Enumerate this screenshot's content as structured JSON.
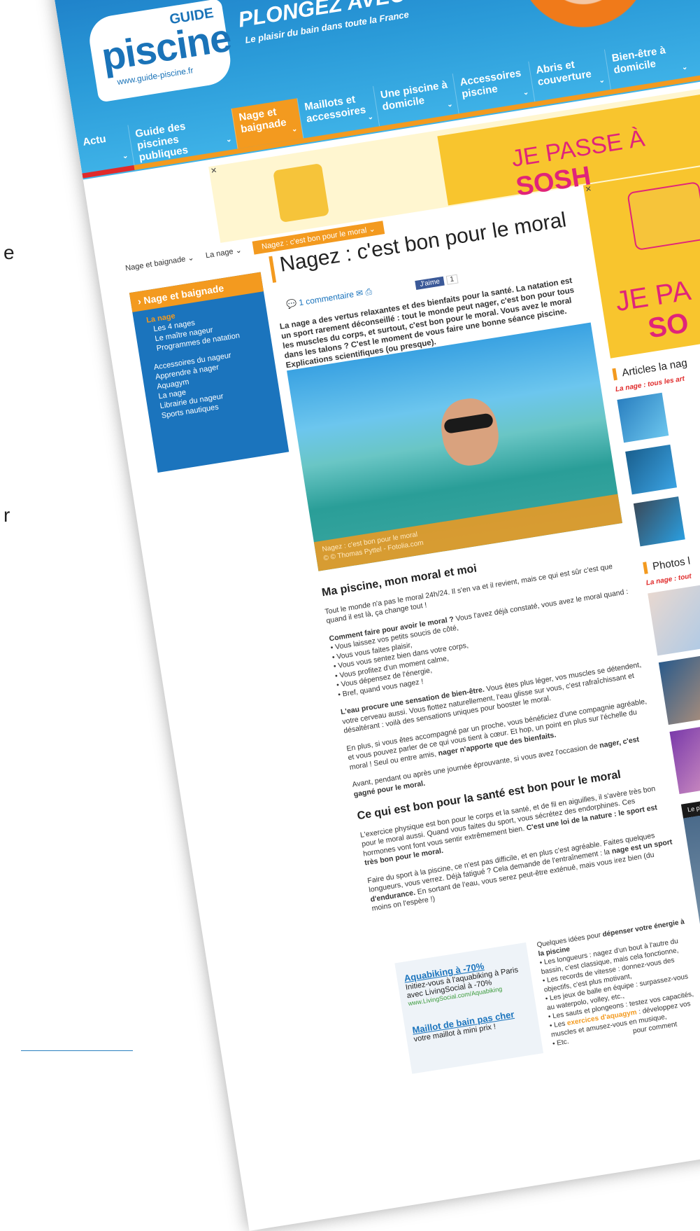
{
  "edge_letters": [
    "e",
    "r"
  ],
  "header": {
    "logo_guide": "GUIDE",
    "logo_piscine": "piscine",
    "logo_url": "www.guide-piscine.fr",
    "slogan": "PLONGEZ AVEC NOUS !",
    "subslogan": "Le plaisir du bain dans toute la France"
  },
  "nav": [
    {
      "label": "Actu"
    },
    {
      "label": "Guide des piscines publiques"
    },
    {
      "label": "Nage et baignade"
    },
    {
      "label": "Maillots et accessoires"
    },
    {
      "label": "Une piscine à domicile"
    },
    {
      "label": "Accessoires piscine"
    },
    {
      "label": "Abris et couverture"
    },
    {
      "label": "Bien-être à domicile"
    }
  ],
  "banner": {
    "text": "JE PASSE À",
    "brand": "SOSH"
  },
  "breadcrumb": [
    "Nage et baignade",
    "La nage",
    "Nagez : c'est bon pour le moral"
  ],
  "sidebar": {
    "heading": "Nage et baignade",
    "items": [
      {
        "label": "La nage"
      },
      {
        "label": "Les 4 nages"
      },
      {
        "label": "Le maître nageur"
      },
      {
        "label": "Programmes de natation"
      },
      {
        "label": "Accessoires du nageur"
      },
      {
        "label": "Apprendre à nager"
      },
      {
        "label": "Aquagym"
      },
      {
        "label": "La nage"
      },
      {
        "label": "Librairie du nageur"
      },
      {
        "label": "Sports nautiques"
      }
    ]
  },
  "article": {
    "title": "Nagez : c'est bon pour le moral",
    "comments": "1 commentaire",
    "like": "J'aime",
    "like_count": "1",
    "intro": "La nage a des vertus relaxantes et des bienfaits pour la santé. La natation est un sport rarement déconseillé : tout le monde peut nager, c'est bon pour tous les muscles du corps, et surtout, c'est bon pour le moral. Vous avez le moral dans les talons ? C'est le moment de vous faire une bonne séance piscine. Explications scientifiques (ou presque).",
    "photo_caption": "Nagez : c'est bon pour le moral",
    "photo_credit": "© © Thomas Pyttel - Fotolia.com",
    "h2_1": "Ma piscine, mon moral et moi",
    "p1": "Tout le monde n'a pas le moral 24h/24. Il s'en va et il revient, mais ce qui est sûr c'est que quand il est là, ça change tout !",
    "p2_lead": "Comment faire pour avoir le moral ?",
    "p2_rest": "Vous l'avez déjà constaté, vous avez le moral quand :",
    "list1": [
      "• Vous laissez vos petits soucis de côté,",
      "• Vous vous faites plaisir,",
      "• Vous vous sentez bien dans votre corps,",
      "• Vous profitez d'un moment calme,",
      "• Vous dépensez de l'énergie,",
      "• Bref, quand vous nagez !"
    ],
    "p3_lead": "L'eau procure une sensation de bien-être.",
    "p3_rest": "Vous êtes plus léger, vos muscles se détendent, votre cerveau aussi. Vous flottez naturellement, l'eau glisse sur vous, c'est rafraîchissant et désaltérant : voilà des sensations uniques pour booster le moral.",
    "p4_a": "En plus, si vous êtes accompagné par un proche, vous bénéficiez d'une compagnie agréable, et vous pouvez parler de ce qui vous tient à cœur. Et hop, un point en plus sur l'échelle du moral ! Seul ou entre amis,",
    "p4_b": "nager n'apporte que des bienfaits.",
    "p5_a": "Avant, pendant ou après une journée éprouvante, si vous avez l'occasion de",
    "p5_b": "nager, c'est gagné pour le moral.",
    "h2_2": "Ce qui est bon pour la santé est bon pour le moral",
    "p6_a": "L'exercice physique est bon pour le corps et la santé, et de fil en aiguilles, il s'avère très bon pour le moral aussi. Quand vous faites du sport, vous sécrétez des endorphines. Ces hormones vont font vous sentir extrêmement bien.",
    "p6_b": "C'est une loi de la nature : le sport est très bon pour le moral.",
    "p7_a": "Faire du sport à la piscine, ce n'est pas difficile, et en plus c'est agréable. Faites quelques longueurs, vous verrez. Déjà fatigué ? Cela demande de l'entraînement : la",
    "p7_b": "nage est un sport d'endurance.",
    "p7_c": "En sortant de l'eau, vous serez peut-être exténué, mais vous irez bien (du moins on l'espère !)",
    "ideas_lead_a": "Quelques idées pour",
    "ideas_lead_b": "dépenser votre énergie à la piscine",
    "ideas": [
      "• Les longueurs : nagez d'un bout à l'autre du bassin, c'est classique, mais cela fonctionne,",
      "• Les records de vitesse : donnez-vous des objectifs, c'est plus motivant,",
      "• Les jeux de balle en équipe : surpassez-vous au waterpolo, volley, etc.,",
      "• Les sauts et plongeons : testez vos capacités,"
    ],
    "ideas_aquagym_a": "• Les",
    "ideas_aquagym_link": "exercices d'aquagym",
    "ideas_aquagym_b": ": développez vos muscles et amusez-vous en musique,",
    "ideas_etc": "• Etc.",
    "ideas_tail": "pour comment"
  },
  "ads": [
    {
      "title": "Aquabiking à -70%",
      "desc": "Initiez-vous à l'aquabiking à Paris avec LivingSocial à -70%",
      "url": "www.LivingSocial.com/Aquabiking"
    },
    {
      "title": "Maillot de bain pas cher",
      "desc": "votre maillot à mini prix !"
    }
  ],
  "right": {
    "ad_line1": "JE PA",
    "ad_line2": "SO",
    "articles_heading": "Articles la nag",
    "articles_sub": "La nage : tous les art",
    "photos_heading": "Photos l",
    "photos_sub": "La nage : tout",
    "video_label": "Le pla"
  }
}
